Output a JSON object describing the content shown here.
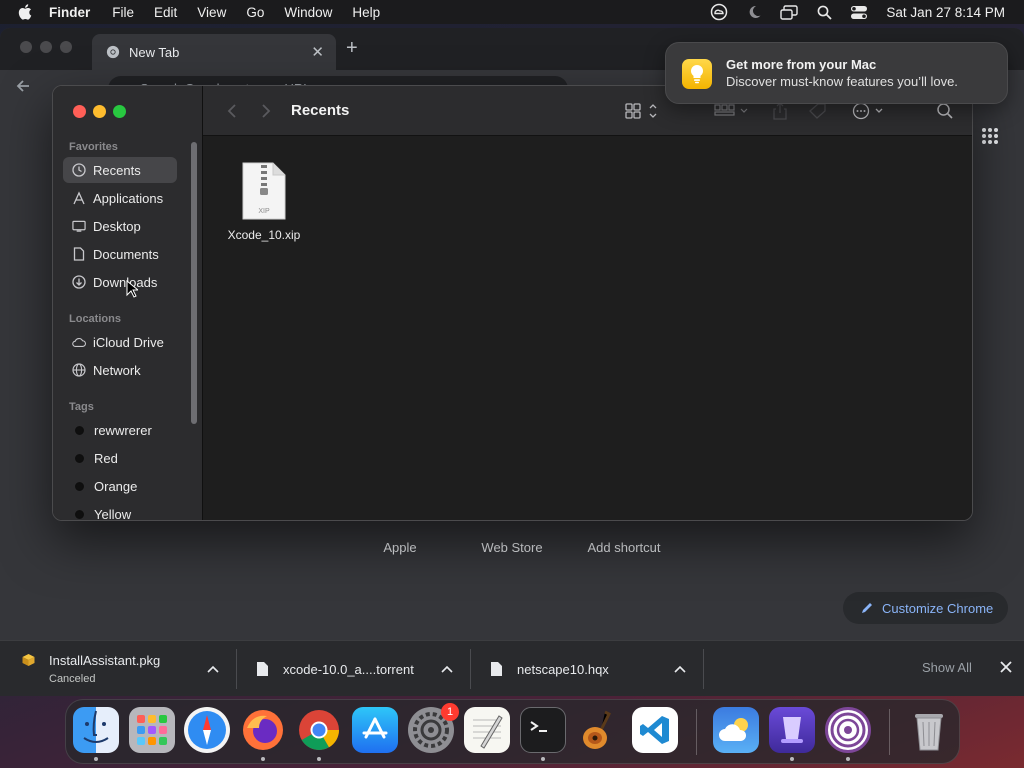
{
  "menubar": {
    "app_name": "Finder",
    "items": [
      "File",
      "Edit",
      "View",
      "Go",
      "Window",
      "Help"
    ],
    "status_icons": [
      "creative-cloud-icon",
      "do-not-disturb-moon-icon",
      "screen-mirroring-icon",
      "spotlight-search-icon",
      "control-center-icon"
    ],
    "clock": "Sat Jan 27  8:14 PM"
  },
  "chrome": {
    "tab_title": "New Tab",
    "omnibox_placeholder": "Search Google or type a URL",
    "shortcuts": [
      "Apple",
      "Web Store",
      "Add shortcut"
    ],
    "customize_label": "Customize Chrome",
    "downloads": [
      {
        "name": "InstallAssistant.pkg",
        "status": "Canceled"
      },
      {
        "name": "xcode-10.0_a....torrent",
        "status": ""
      },
      {
        "name": "netscape10.hqx",
        "status": ""
      }
    ],
    "show_all": "Show All"
  },
  "notification": {
    "title": "Get more from your Mac",
    "body": "Discover must-know features you’ll love."
  },
  "finder": {
    "title": "Recents",
    "sidebar": {
      "favorites_header": "Favorites",
      "favorites": [
        {
          "label": "Recents",
          "icon": "clock-icon",
          "selected": true
        },
        {
          "label": "Applications",
          "icon": "applications-icon",
          "selected": false
        },
        {
          "label": "Desktop",
          "icon": "desktop-icon",
          "selected": false
        },
        {
          "label": "Documents",
          "icon": "document-icon",
          "selected": false
        },
        {
          "label": "Downloads",
          "icon": "download-icon",
          "selected": false
        }
      ],
      "locations_header": "Locations",
      "locations": [
        {
          "label": "iCloud Drive",
          "icon": "cloud-icon"
        },
        {
          "label": "Network",
          "icon": "network-icon"
        }
      ],
      "tags_header": "Tags",
      "tags": [
        {
          "label": "rewwrerer",
          "color": "#0f0f0f"
        },
        {
          "label": "Red",
          "color": "#0f0f0f"
        },
        {
          "label": "Orange",
          "color": "#0f0f0f"
        },
        {
          "label": "Yellow",
          "color": "#0f0f0f"
        }
      ]
    },
    "files": [
      {
        "name": "Xcode_10.xip",
        "type_label": "XIP"
      }
    ]
  },
  "dock": {
    "apps": [
      "Finder",
      "Launchpad",
      "Safari",
      "Firefox",
      "Google Chrome",
      "App Store",
      "System Settings",
      "TextEdit",
      "Terminal",
      "GarageBand",
      "Visual Studio Code",
      "Weather",
      "Apple Configurator",
      "Tor Browser",
      "Trash"
    ],
    "system_settings_badge": "1"
  },
  "colors": {
    "accent_link": "#8ab4f8",
    "traffic_red": "#ff5f57",
    "traffic_yellow": "#febc2e",
    "traffic_green": "#28c840",
    "badge_red": "#ff3b30"
  }
}
